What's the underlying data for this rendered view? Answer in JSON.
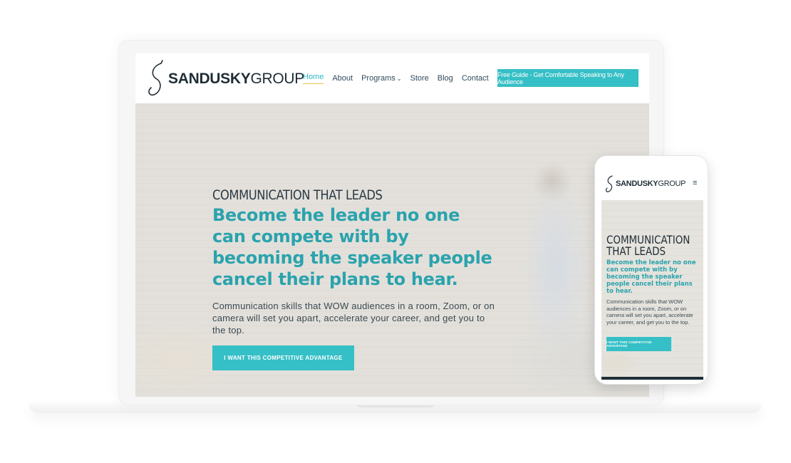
{
  "laptop": {
    "logo": {
      "bold": "SANDUSKY",
      "light": "GROUP"
    },
    "nav": [
      {
        "label": "Home",
        "active": true
      },
      {
        "label": "About"
      },
      {
        "label": "Programs",
        "has_dropdown": true
      },
      {
        "label": "Store"
      },
      {
        "label": "Blog"
      },
      {
        "label": "Contact"
      }
    ],
    "cta_top": "Free Guide - Get Comfortable Speaking to Any Audience",
    "hero": {
      "eyebrow": "COMMUNICATION THAT LEADS",
      "headline": "Become the leader no one can compete with by becoming the speaker people cancel their plans to hear.",
      "body": "Communication skills that WOW audiences in a room, Zoom, or on camera will set you apart, accelerate your career, and get you to the top.",
      "button": "I WANT THIS COMPETITIVE ADVANTAGE"
    }
  },
  "phone": {
    "logo": {
      "bold": "SANDUSKY",
      "light": "GROUP"
    },
    "menu_icon": "hamburger-icon",
    "hero": {
      "eyebrow": "COMMUNICATION THAT LEADS",
      "headline": "Become the leader no one can compete with by becoming the speaker people cancel their plans to hear.",
      "body": "Communication skills that WOW audiences in a room, Zoom, or on camera will set you apart, accelerate your career, and get you to the top.",
      "button": "I WANT THIS COMPETITIVE ADVANTAGE"
    }
  },
  "colors": {
    "accent": "#35bfc6",
    "headline": "#2aa3ad",
    "nav_active_underline": "#e8c04a",
    "dark_text": "#1f2d36"
  }
}
